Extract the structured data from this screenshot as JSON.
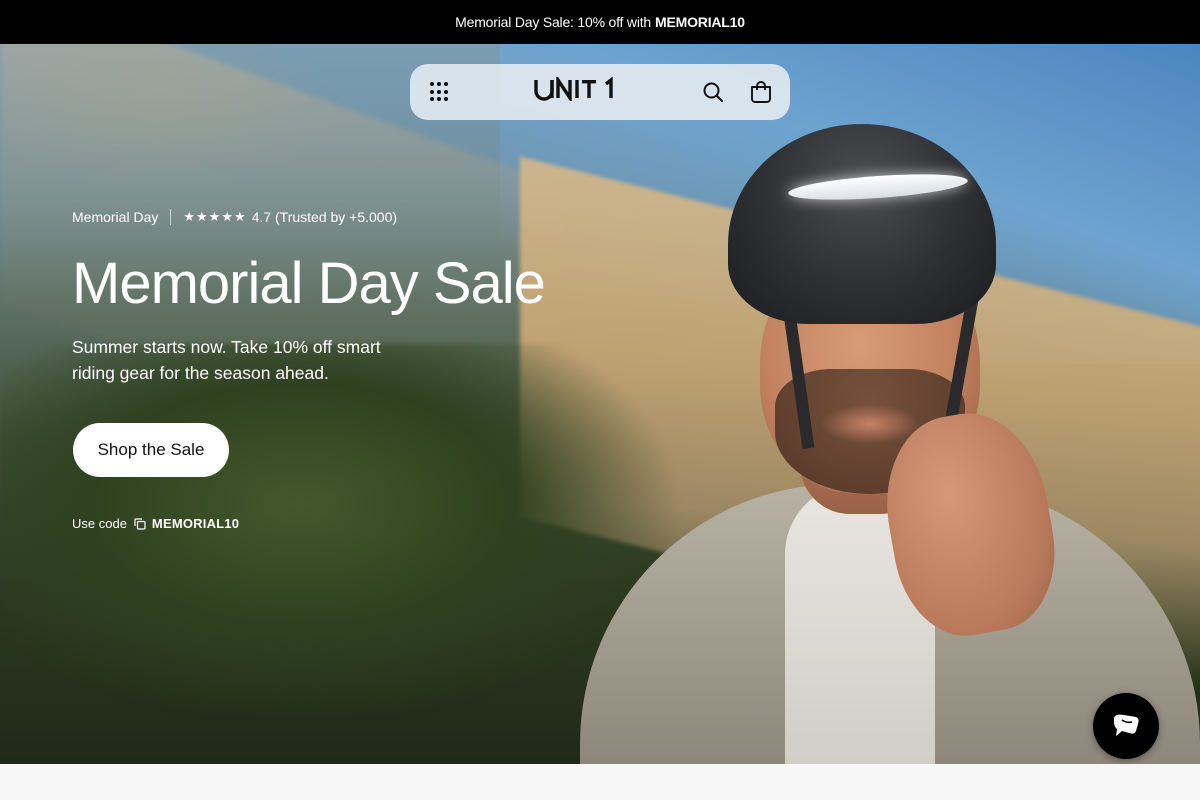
{
  "announcement": {
    "text": "Memorial Day Sale: 10% off with",
    "code": "MEMORIAL10"
  },
  "nav": {
    "logo": "UNIT 1",
    "icons": [
      "menu-grid-icon",
      "search-icon",
      "cart-icon"
    ]
  },
  "hero": {
    "tag": "Memorial Day",
    "stars": "★★★★★",
    "rating": "4.7",
    "trusted": "(Trusted by +5.000)",
    "title": "Memorial Day Sale",
    "subtitle": "Summer starts now. Take 10% off smart riding gear for the season ahead.",
    "cta_label": "Shop the Sale",
    "code_label": "Use code",
    "code": "MEMORIAL10"
  },
  "chat": {
    "icon": "chat-icon"
  },
  "colors": {
    "announcement_bg": "#000000",
    "cta_bg": "#ffffff",
    "nav_bg": "#e1e8f0"
  }
}
